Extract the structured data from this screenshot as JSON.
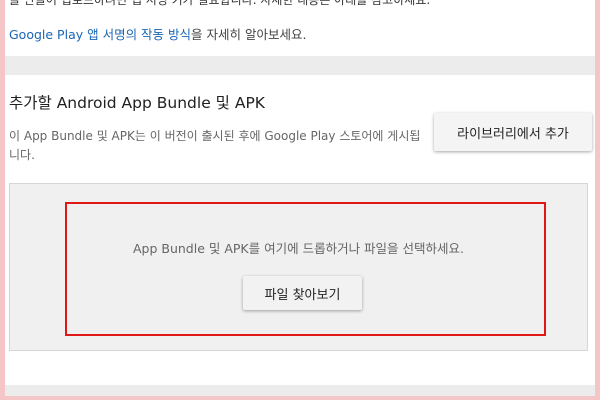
{
  "top": {
    "cut_text": "을 만들어 업로드하려면 앱 서명 키가 필요합니다. 자세한 내용은 아래를 참고하세요.",
    "link": "Google Play 앱 서명의 작동 방식",
    "link_suffix": "을 자세히 알아보세요."
  },
  "section": {
    "title": "추가할 Android App Bundle 및 APK",
    "description": "이 App Bundle 및 APK는 이 버전이 출시된 후에 Google Play 스토어에 게시됩니다.",
    "add_button": "라이브러리에서 추가"
  },
  "dropzone": {
    "text": "App Bundle 및 APK를 여기에 드롭하거나 파일을 선택하세요.",
    "browse_button": "파일 찾아보기"
  },
  "colors": {
    "link": "#1a66b3",
    "highlight": "#e01717",
    "frame_border": "#f5c6c8"
  }
}
